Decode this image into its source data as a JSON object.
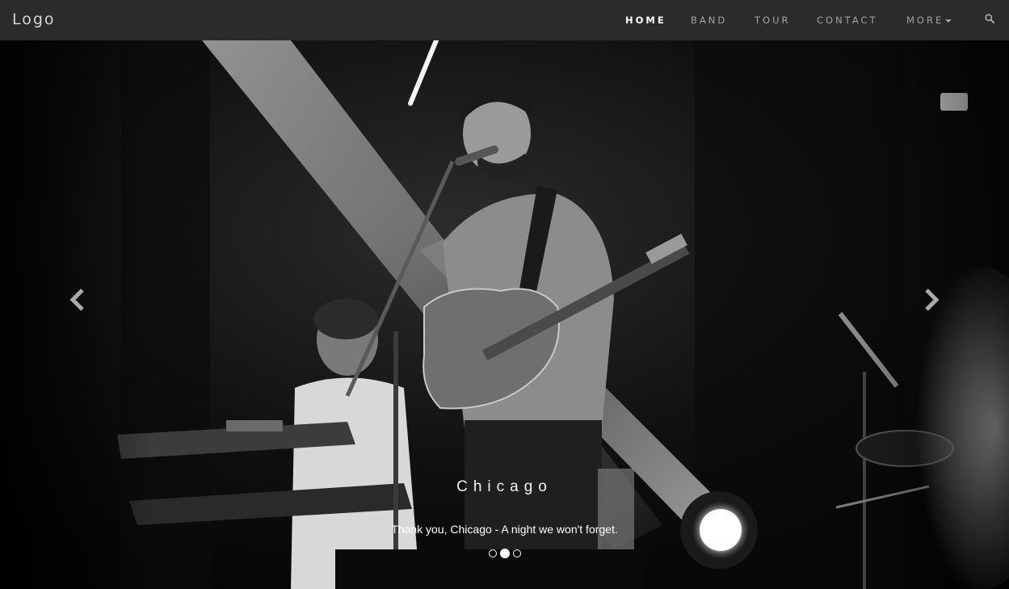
{
  "navbar": {
    "logo": "Logo",
    "items": [
      {
        "label": "HOME",
        "active": true
      },
      {
        "label": "BAND"
      },
      {
        "label": "TOUR"
      },
      {
        "label": "CONTACT"
      },
      {
        "label": "MORE"
      }
    ],
    "search_icon": "search-icon"
  },
  "carousel": {
    "caption_title": "Chicago",
    "caption_text": "Thank you, Chicago - A night we won't forget.",
    "active_slide": 2,
    "slide_count": 3,
    "prev_icon": "chevron-left-icon",
    "next_icon": "chevron-right-icon"
  },
  "colors": {
    "navbar_bg": "#2b2b2d",
    "nav_text": "#a3a3a3",
    "nav_active": "#ffffff"
  }
}
